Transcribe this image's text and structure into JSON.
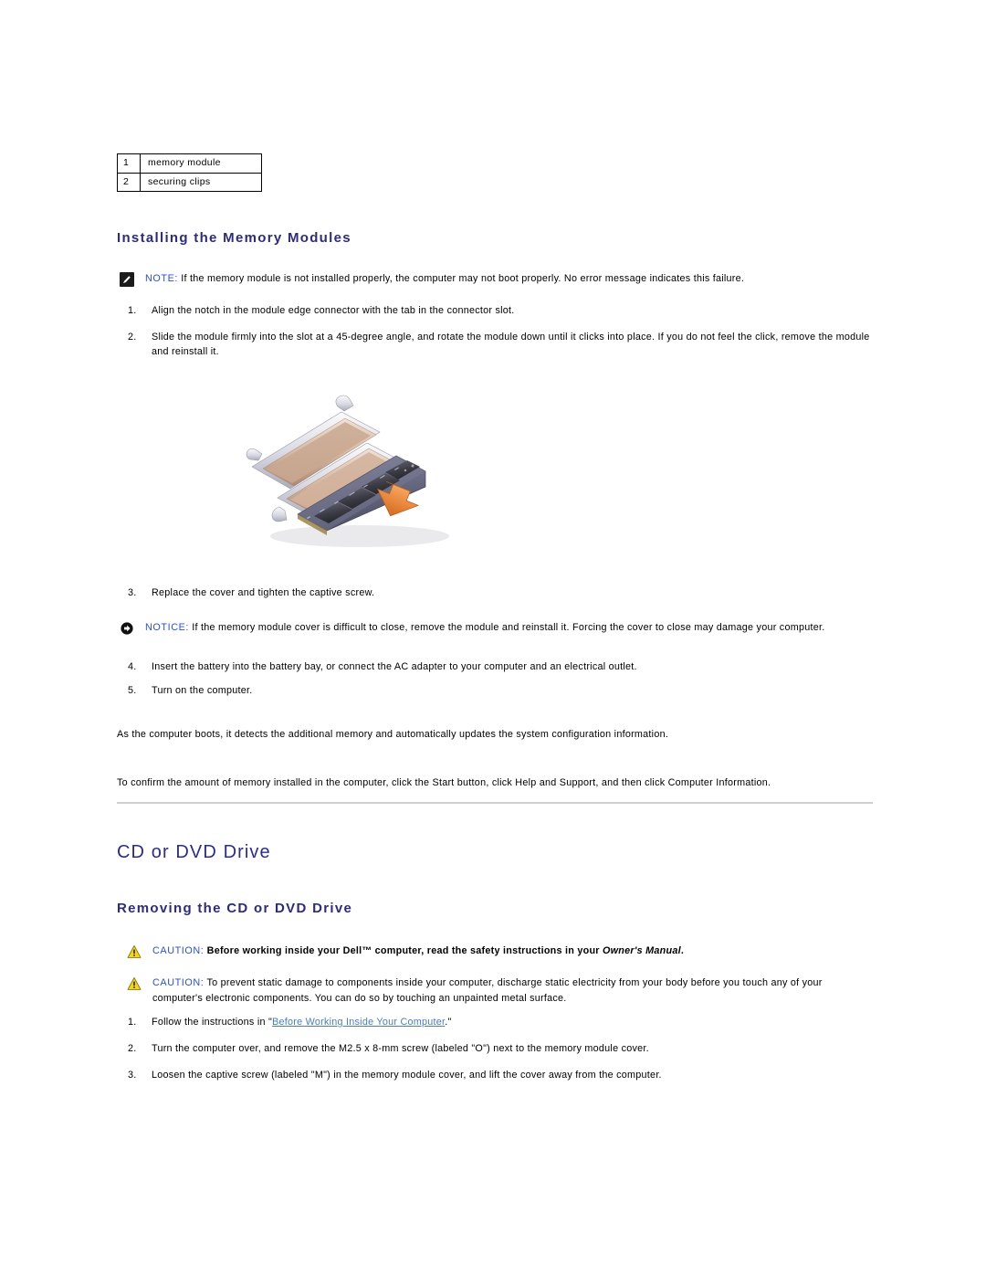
{
  "legend": {
    "rows": [
      {
        "num": "1",
        "label": "memory module"
      },
      {
        "num": "2",
        "label": "securing clips"
      }
    ]
  },
  "headings": {
    "installing_memory_modules": "Installing the Memory Modules",
    "cd_or_dvd_drive": "CD or DVD Drive",
    "removing_cd_or_dvd_drive": "Removing the CD or DVD Drive"
  },
  "note_1": {
    "keyword": "NOTE:",
    "text": " If the memory module is not installed properly, the computer may not boot properly. No error message indicates this failure.",
    "icon": "note-pencil-icon"
  },
  "notice_1": {
    "keyword": "NOTICE:",
    "text": " If the memory module cover is difficult to close, remove the module and reinstall it. Forcing the cover to close may damage your computer.",
    "icon": "notice-arrow-icon"
  },
  "caution_1": {
    "keyword": "CAUTION:",
    "text": " Before working inside your Dell™ computer, read the safety instructions in your ",
    "italic_text": "Owner's Manual",
    "trailing": ".",
    "icon": "caution-triangle-icon"
  },
  "caution_2": {
    "keyword": "CAUTION:",
    "text": " To prevent static damage to components inside your computer, discharge static electricity from your body before you touch any of your computer's electronic components. You can do so by touching an unpainted metal surface.",
    "icon": "caution-triangle-icon"
  },
  "steps_install": [
    {
      "n": "1.",
      "text": "Align the notch in the module edge connector with the tab in the connector slot."
    },
    {
      "n": "2.",
      "text": "Slide the module firmly into the slot at a 45-degree angle, and rotate the module down until it clicks into place. If you do not feel the click, remove the module and reinstall it."
    }
  ],
  "steps_mid": [
    {
      "n": "3.",
      "text": "Replace the cover and tighten the captive screw."
    }
  ],
  "steps_mid2": [
    {
      "n": "4.",
      "text": "Insert the battery into the battery bay, or connect the AC adapter to your computer and an electrical outlet."
    },
    {
      "n": "5.",
      "text": "Turn on the computer."
    }
  ],
  "paragraphs": {
    "boots": "As the computer boots, it detects the additional memory and automatically updates the system configuration information.",
    "confirm": "To confirm the amount of memory installed in the computer, click the Start button, click Help and Support, and then click Computer Information."
  },
  "steps_remove": [
    {
      "n": "1.",
      "prefix": "Follow the instructions in \"",
      "link": "Before Working Inside Your Computer",
      "suffix": ".\""
    },
    {
      "n": "2.",
      "text": "Turn the computer over, and remove the M2.5 x 8-mm screw (labeled \"O\") next to the memory module cover."
    },
    {
      "n": "3.",
      "text": "Loosen the captive screw (labeled \"M\") in the memory module cover, and lift the cover away from the computer."
    }
  ],
  "figure": {
    "alt": "memory-module-installation-photo",
    "description": "SODIMM memory module being inserted into a laptop memory socket with an orange arrow indicating downward rotation"
  },
  "colors": {
    "heading_sub": "#2B2B80",
    "heading_main": "#2B2B95",
    "keyword_blue": "#2B4FD6",
    "link_blue": "#4A7EBB",
    "caution_yellow": "#F5D31E",
    "arrow_orange": "#E8833A",
    "divider_gray": "#cfcfcf"
  }
}
